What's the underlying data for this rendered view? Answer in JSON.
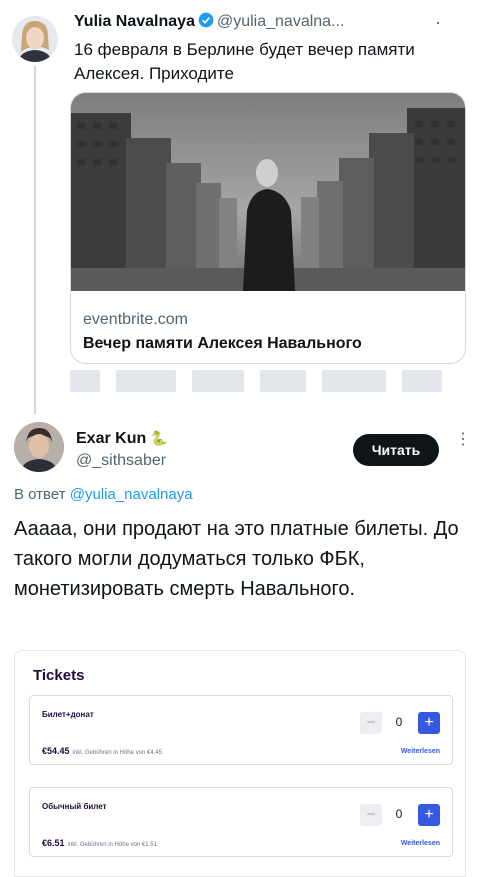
{
  "tweet_original": {
    "author_name": "Yulia Navalnaya",
    "verified_icon": "verified-badge-icon",
    "handle": "@yulia_navalna...",
    "more_label": "·",
    "text": "16 февраля в Берлине будет вечер памяти Алексея. Приходите",
    "link_card": {
      "domain": "eventbrite.com",
      "title": "Вечер памяти Алексея Навального"
    }
  },
  "tweet_reply": {
    "author_name": "Exar Kun",
    "name_emoji": "🐍",
    "handle": "@_sithsaber",
    "read_button": "Читать",
    "more_label": "⋮",
    "reply_prefix": "В ответ",
    "reply_to_handle": "@yulia_navalnaya",
    "text": "Ааааа, они продают на это платные билеты. До такого могли додуматься только ФБК, монетизировать смерть Навального."
  },
  "tickets": {
    "title": "Tickets",
    "items": [
      {
        "name": "Билет+донат",
        "price": "€54.45",
        "fee_note": "inkl. Gebühren in Höhe von €4.45",
        "quantity": "0",
        "minus": "−",
        "plus": "+",
        "more_link": "Weiterlesen"
      },
      {
        "name": "Обычный билет",
        "price": "€6.51",
        "fee_note": "inkl. Gebühren in Höhe von €1.51",
        "quantity": "0",
        "minus": "−",
        "plus": "+",
        "more_link": "Weiterlesen"
      }
    ]
  },
  "colors": {
    "link_blue": "#1d9bf0",
    "eventbrite_blue": "#3659e3",
    "text_primary": "#0f1419",
    "text_secondary": "#536471"
  }
}
